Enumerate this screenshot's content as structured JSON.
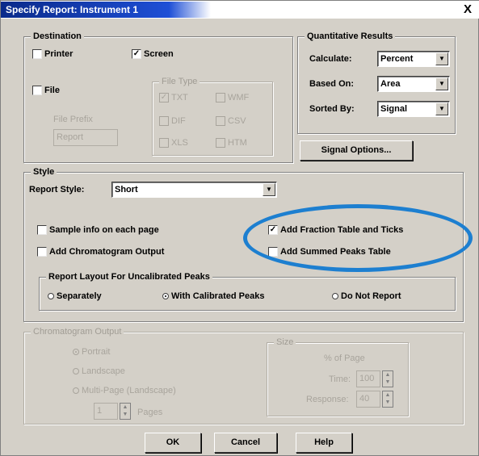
{
  "window": {
    "title": "Specify Report: Instrument 1",
    "close_glyph": "X"
  },
  "destination": {
    "legend": "Destination",
    "printer_label": "Printer",
    "printer_checked": false,
    "screen_label": "Screen",
    "screen_checked": true,
    "file_label": "File",
    "file_checked": false,
    "file_prefix_label": "File Prefix",
    "file_prefix_value": "Report",
    "file_type": {
      "legend": "File Type",
      "options": [
        {
          "label": "TXT",
          "checked": true
        },
        {
          "label": "WMF",
          "checked": false
        },
        {
          "label": "DIF",
          "checked": false
        },
        {
          "label": "CSV",
          "checked": false
        },
        {
          "label": "XLS",
          "checked": false
        },
        {
          "label": "HTM",
          "checked": false
        }
      ]
    }
  },
  "quantitative": {
    "legend": "Quantitative Results",
    "calculate_label": "Calculate:",
    "calculate_value": "Percent",
    "based_on_label": "Based On:",
    "based_on_value": "Area",
    "sorted_by_label": "Sorted By:",
    "sorted_by_value": "Signal",
    "signal_options_button": "Signal Options..."
  },
  "style": {
    "legend": "Style",
    "report_style_label": "Report Style:",
    "report_style_value": "Short",
    "sample_info_label": "Sample info on each page",
    "sample_info_checked": false,
    "add_chromatogram_label": "Add Chromatogram Output",
    "add_chromatogram_checked": false,
    "add_fraction_label": "Add Fraction Table and Ticks",
    "add_fraction_checked": true,
    "add_summed_label": "Add Summed Peaks Table",
    "add_summed_checked": false,
    "layout": {
      "legend": "Report Layout For Uncalibrated Peaks",
      "options": [
        "Separately",
        "With Calibrated Peaks",
        "Do Not Report"
      ],
      "selected": "With Calibrated Peaks"
    }
  },
  "chromatogram": {
    "legend": "Chromatogram Output",
    "orientation_options": [
      "Portrait",
      "Landscape",
      "Multi-Page (Landscape)"
    ],
    "orientation_selected": "Portrait",
    "pages_value": "1",
    "pages_label": "Pages",
    "size": {
      "legend": "Size",
      "percent_label": "% of Page",
      "time_label": "Time:",
      "time_value": "100",
      "response_label": "Response:",
      "response_value": "40"
    }
  },
  "buttons": {
    "ok": "OK",
    "cancel": "Cancel",
    "help": "Help"
  },
  "colors": {
    "dialog_bg": "#d4d0c8",
    "title_start": "#0a2a8a",
    "title_end": "#1e4fd6",
    "highlight": "#1d7fd0",
    "disabled_text": "#a8a49c"
  },
  "icons": {
    "dropdown": "chevron-down-icon",
    "checkmark": "checkmark-icon",
    "spin_up": "arrow-up-icon",
    "spin_down": "arrow-down-icon"
  }
}
